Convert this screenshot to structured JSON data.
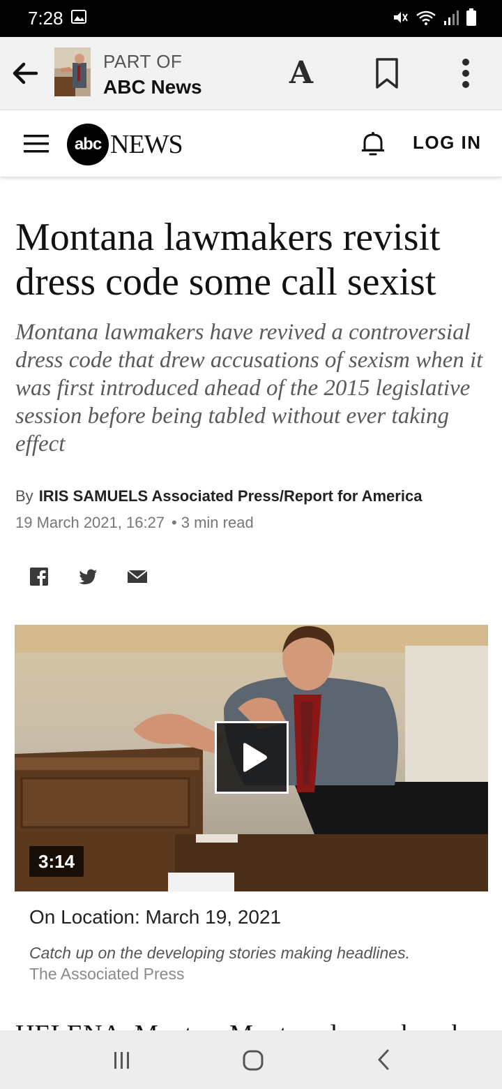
{
  "status_bar": {
    "time": "7:28",
    "icons": [
      "gallery-icon",
      "mute-icon",
      "wifi-icon",
      "signal-icon",
      "battery-icon"
    ]
  },
  "app_bar": {
    "part_of_label": "PART OF",
    "publication": "ABC News",
    "text_size_label": "A"
  },
  "site_header": {
    "logo_abc": "abc",
    "logo_news": "NEWS",
    "login_label": "LOG IN"
  },
  "article": {
    "headline": "Montana lawmakers revisit dress code some call sexist",
    "subheadline": "Montana lawmakers have revived a controversial dress code that drew accusations of sexism when it was first introduced ahead of the 2015 legislative session before being tabled without ever taking effect",
    "byline_prefix": "By",
    "author": "IRIS SAMUELS Associated Press/Report for America",
    "date": "19 March 2021, 16:27",
    "dot": "•",
    "read_time": "3 min read",
    "body_start": "HELENA, Mont. -- Montana lawmakers have"
  },
  "share": [
    "facebook-icon",
    "twitter-icon",
    "email-icon"
  ],
  "video": {
    "duration": "3:14",
    "caption_title": "On Location: March 19, 2021",
    "caption_description": "Catch up on the developing stories making headlines.",
    "caption_credit": "The Associated Press"
  },
  "colors": {
    "status_bar": "#000000",
    "app_bar": "#f2f2f2",
    "nav_bar": "#ededed",
    "subhead_text": "#5a5a5a"
  }
}
